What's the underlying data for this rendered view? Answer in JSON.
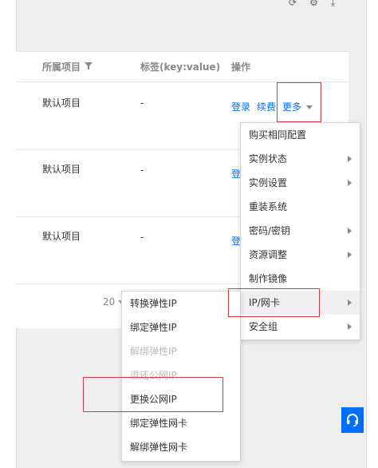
{
  "table": {
    "headers": {
      "project": "所属项目",
      "tags": "标签(key:value)",
      "ops": "操作"
    },
    "rows": [
      {
        "project": "默认项目",
        "tags": "-",
        "login": "登录",
        "renew": "续费",
        "more": "更多"
      },
      {
        "project": "默认项目",
        "tags": "-",
        "login": "登"
      },
      {
        "project": "默认项目",
        "tags": "-",
        "login": "登"
      }
    ],
    "page_size": "20"
  },
  "more_menu": {
    "items": [
      {
        "label": "购买相同配置",
        "submenu": false
      },
      {
        "label": "实例状态",
        "submenu": true
      },
      {
        "label": "实例设置",
        "submenu": true
      },
      {
        "label": "重装系统",
        "submenu": false
      },
      {
        "label": "密码/密钥",
        "submenu": true
      },
      {
        "label": "资源调整",
        "submenu": true
      },
      {
        "label": "制作镜像",
        "submenu": false
      },
      {
        "label": "IP/网卡",
        "submenu": true,
        "active": true
      },
      {
        "label": "安全组",
        "submenu": true
      }
    ]
  },
  "ip_submenu": {
    "items": [
      {
        "label": "转换弹性IP",
        "disabled": false
      },
      {
        "label": "绑定弹性IP",
        "disabled": false
      },
      {
        "label": "解绑弹性IP",
        "disabled": true
      },
      {
        "label": "退还公网IP",
        "disabled": true
      },
      {
        "label": "更换公网IP",
        "disabled": false
      },
      {
        "label": "绑定弹性网卡",
        "disabled": false
      },
      {
        "label": "解绑弹性网卡",
        "disabled": false
      }
    ]
  },
  "icons": {
    "filter": "filter-icon",
    "caret": "caret-down-icon",
    "submenu_arrow": "chevron-right-icon",
    "support": "headset-icon"
  },
  "colors": {
    "link": "#006eff",
    "highlight_border": "#d9363e",
    "support_bg": "#006eff"
  }
}
